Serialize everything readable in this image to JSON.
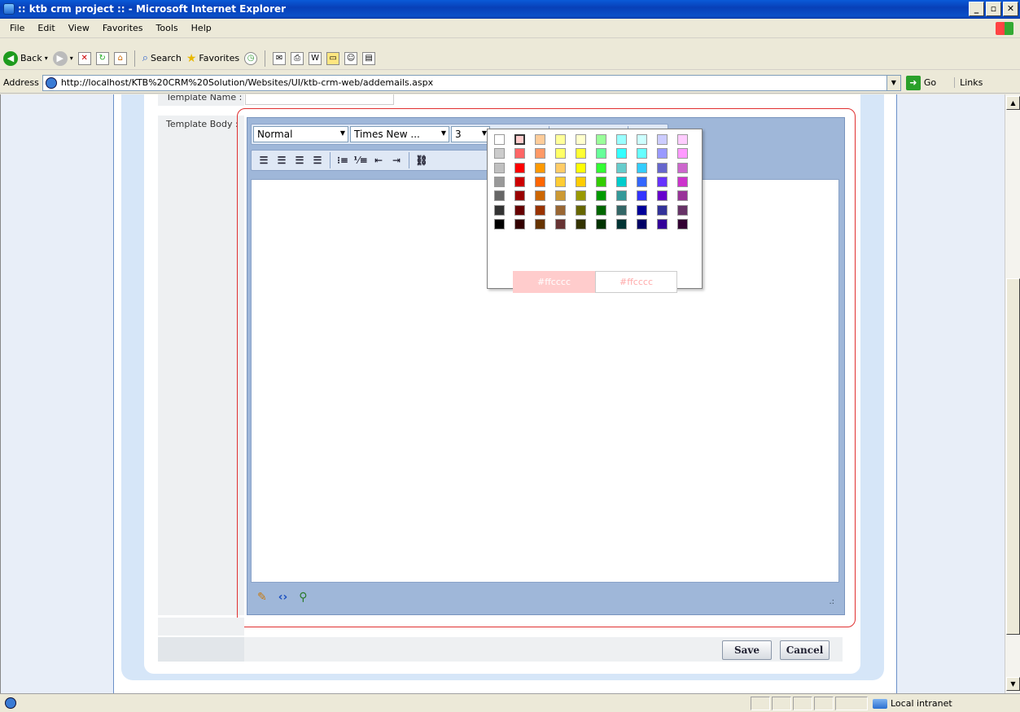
{
  "window": {
    "title": ":: ktb crm project :: - Microsoft Internet Explorer",
    "min": "_",
    "max": "▫",
    "close": "✕"
  },
  "menu": [
    "File",
    "Edit",
    "View",
    "Favorites",
    "Tools",
    "Help"
  ],
  "toolbar": {
    "back": "Back",
    "search": "Search",
    "favorites": "Favorites"
  },
  "address": {
    "label": "Address",
    "url": "http://localhost/KTB%20CRM%20Solution/Websites/UI/ktb-crm-web/addemails.aspx",
    "go": "Go",
    "links": "Links"
  },
  "form": {
    "template_name_label": "Template Name :",
    "template_body_label": "Template Body :",
    "save": "Save",
    "cancel": "Cancel"
  },
  "editor": {
    "format": "Normal",
    "font": "Times New ...",
    "size": "3",
    "font_color_icon": "font-color-icon",
    "highlight_icon": "paint-bucket-icon"
  },
  "color_picker": {
    "selected": "#ffcccc",
    "preview_label_a": "#ffcccc",
    "preview_label_b": "#ffcccc",
    "columns": [
      [
        "#ffffff",
        "#cccccc",
        "#c0c0c0",
        "#999999",
        "#666666",
        "#333333",
        "#000000"
      ],
      [
        "#ffcccc",
        "#ff6666",
        "#ff0000",
        "#cc0000",
        "#990000",
        "#660000",
        "#330000"
      ],
      [
        "#ffcc99",
        "#ff9966",
        "#ff9900",
        "#ff6600",
        "#cc6600",
        "#993300",
        "#663300"
      ],
      [
        "#ffff99",
        "#ffff66",
        "#ffcc66",
        "#ffcc33",
        "#cc9933",
        "#996633",
        "#663333"
      ],
      [
        "#ffffcc",
        "#ffff33",
        "#ffff00",
        "#ffcc00",
        "#999900",
        "#666600",
        "#333300"
      ],
      [
        "#99ff99",
        "#66ff99",
        "#33ff33",
        "#33cc00",
        "#009900",
        "#006600",
        "#003300"
      ],
      [
        "#99ffff",
        "#33ffff",
        "#66cccc",
        "#00cccc",
        "#339999",
        "#336666",
        "#003333"
      ],
      [
        "#ccffff",
        "#66ffff",
        "#33ccff",
        "#3366ff",
        "#3333ff",
        "#000099",
        "#000066"
      ],
      [
        "#ccccff",
        "#9999ff",
        "#6666cc",
        "#6633ff",
        "#6600cc",
        "#333399",
        "#330099"
      ],
      [
        "#ffccff",
        "#ff99ff",
        "#cc66cc",
        "#cc33cc",
        "#993399",
        "#663366",
        "#330033"
      ]
    ]
  },
  "status": {
    "zone": "Local intranet"
  }
}
